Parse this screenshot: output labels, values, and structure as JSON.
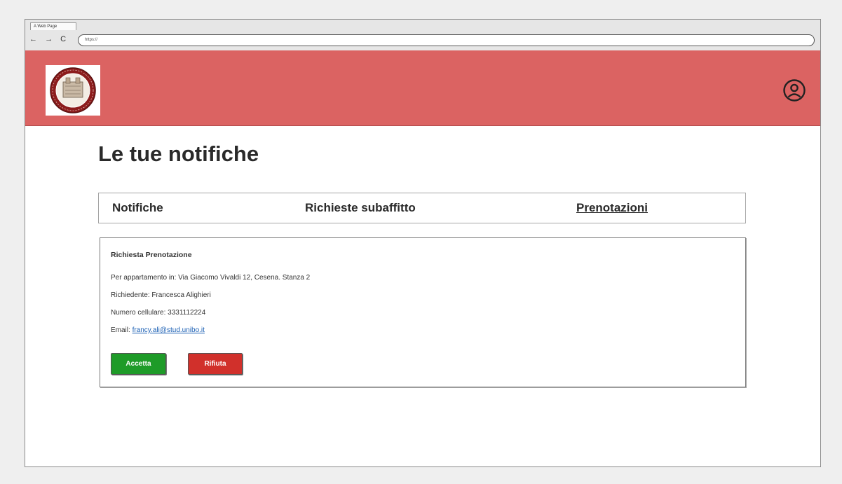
{
  "browser": {
    "tab_title": "A Web Page",
    "nav": {
      "back": "←",
      "forward": "→",
      "reload": "C"
    },
    "url": "https://"
  },
  "header": {
    "logo_icon": "university-seal",
    "user_icon": "user-account-icon",
    "bg_color": "#db6362"
  },
  "page": {
    "title": "Le tue notifiche"
  },
  "tabs": [
    {
      "label": "Notifiche"
    },
    {
      "label": "Richieste subaffitto"
    },
    {
      "label": "Prenotazioni",
      "active": true
    }
  ],
  "notification": {
    "heading": "Richiesta Prenotazione",
    "apartment": "Per appartamento in: Via Giacomo Vivaldi 12, Cesena.  Stanza 2",
    "requester": "Richiedente: Francesca Alighieri",
    "phone": "Numero cellulare: 3331112224",
    "email_label": "Email:",
    "email": "francy.ali@stud.unibo.it",
    "accept_label": "Accetta",
    "reject_label": "Rifiuta",
    "accept_color": "#1e9b28",
    "reject_color": "#d1302b"
  }
}
